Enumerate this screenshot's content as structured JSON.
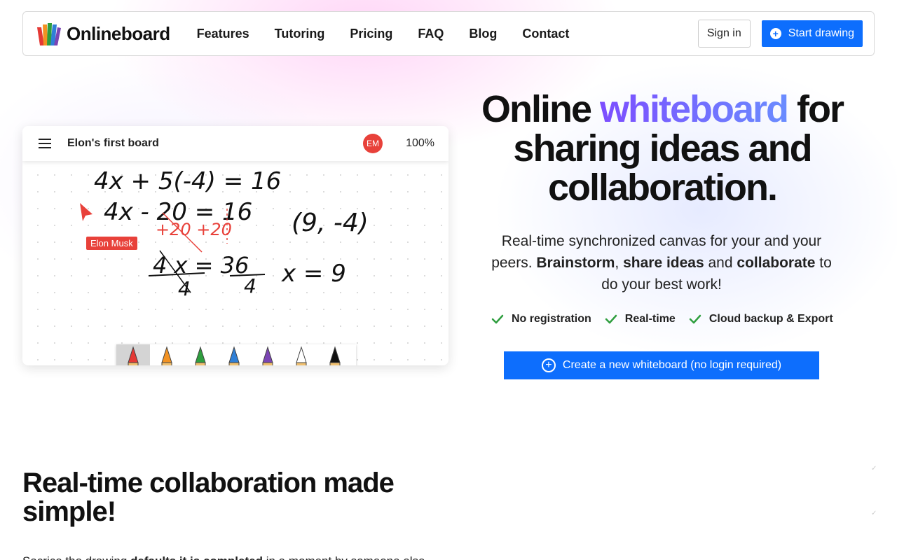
{
  "nav": {
    "logo_text": "Onlineboard",
    "links": [
      "Features",
      "Tutoring",
      "Pricing",
      "FAQ",
      "Blog",
      "Contact"
    ],
    "signin_label": "Sign in",
    "start_label": "Start drawing"
  },
  "board": {
    "title": "Elon's first board",
    "avatar_initials": "EM",
    "zoom": "100%",
    "cursor_user": "Elon Musk",
    "math_lines": [
      "4x + 5(-4) = 16",
      "4x - 20 = 16",
      "+20 +20",
      "(9, -4)",
      "4x/4 = 36/4",
      "x = 9"
    ],
    "pen_colors": [
      "#e53935",
      "#f29222",
      "#2e9e3e",
      "#2f7fd6",
      "#7b45b4",
      "#ffffff",
      "#111111"
    ]
  },
  "hero": {
    "title_part1": "Online ",
    "title_highlight": "whiteboard",
    "title_part2": " for sharing ideas and collaboration.",
    "sub_part1": "Real-time synchronized canvas for your and your peers. ",
    "sub_bold1": "Brainstorm",
    "sub_sep": ", ",
    "sub_bold2": "share ideas",
    "sub_part2": " and ",
    "sub_bold3": "collaborate",
    "sub_part3": " to do your best work!",
    "features": [
      "No registration",
      "Real-time",
      "Cloud backup & Export"
    ],
    "cta_label": "Create a new whiteboard (no login required)"
  },
  "section": {
    "title": "Real-time collaboration made simple!",
    "text_part1": "Sacrice the drawing ",
    "text_bold": "defaults it is completed",
    "text_part2": " in a moment by someone else"
  },
  "colors": {
    "primary": "#0d6efd",
    "accent_red": "#e8413a",
    "check_green": "#2e9e3e"
  }
}
